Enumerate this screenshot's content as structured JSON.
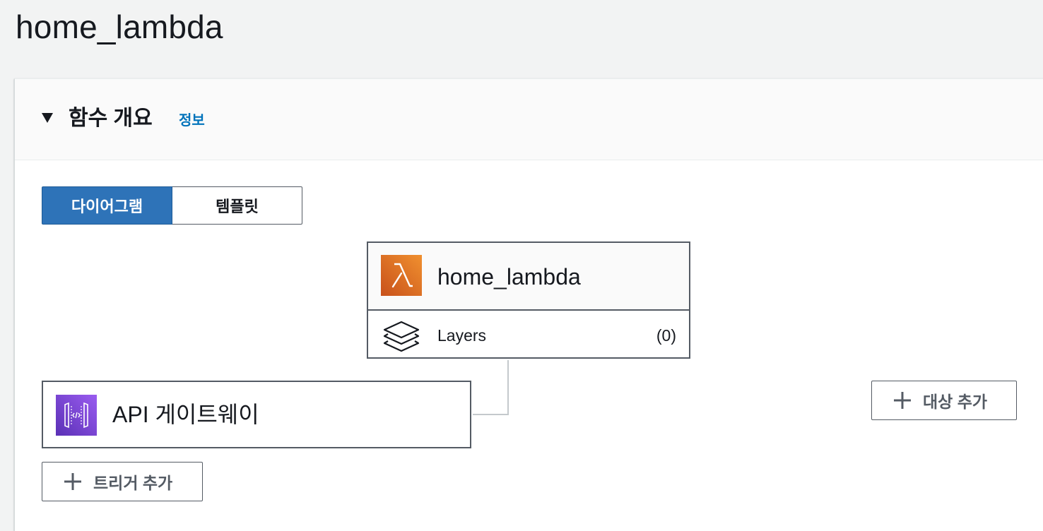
{
  "page": {
    "title": "home_lambda"
  },
  "overview": {
    "title": "함수 개요",
    "info_link": "정보",
    "view_tabs": [
      {
        "label": "다이어그램",
        "active": true
      },
      {
        "label": "템플릿",
        "active": false
      }
    ]
  },
  "function_node": {
    "name": "home_lambda",
    "icon": "lambda-icon",
    "layers_label": "Layers",
    "layers_count": "(0)"
  },
  "trigger_node": {
    "name": "API 게이트웨이",
    "icon": "api-gateway-icon"
  },
  "buttons": {
    "add_trigger": "트리거 추가",
    "add_destination": "대상 추가"
  },
  "colors": {
    "accent": "#2e73b8",
    "link": "#0073bb",
    "lambda_orange": "#e07b24",
    "api_purple": "#7b47d6",
    "border": "#545b64"
  }
}
